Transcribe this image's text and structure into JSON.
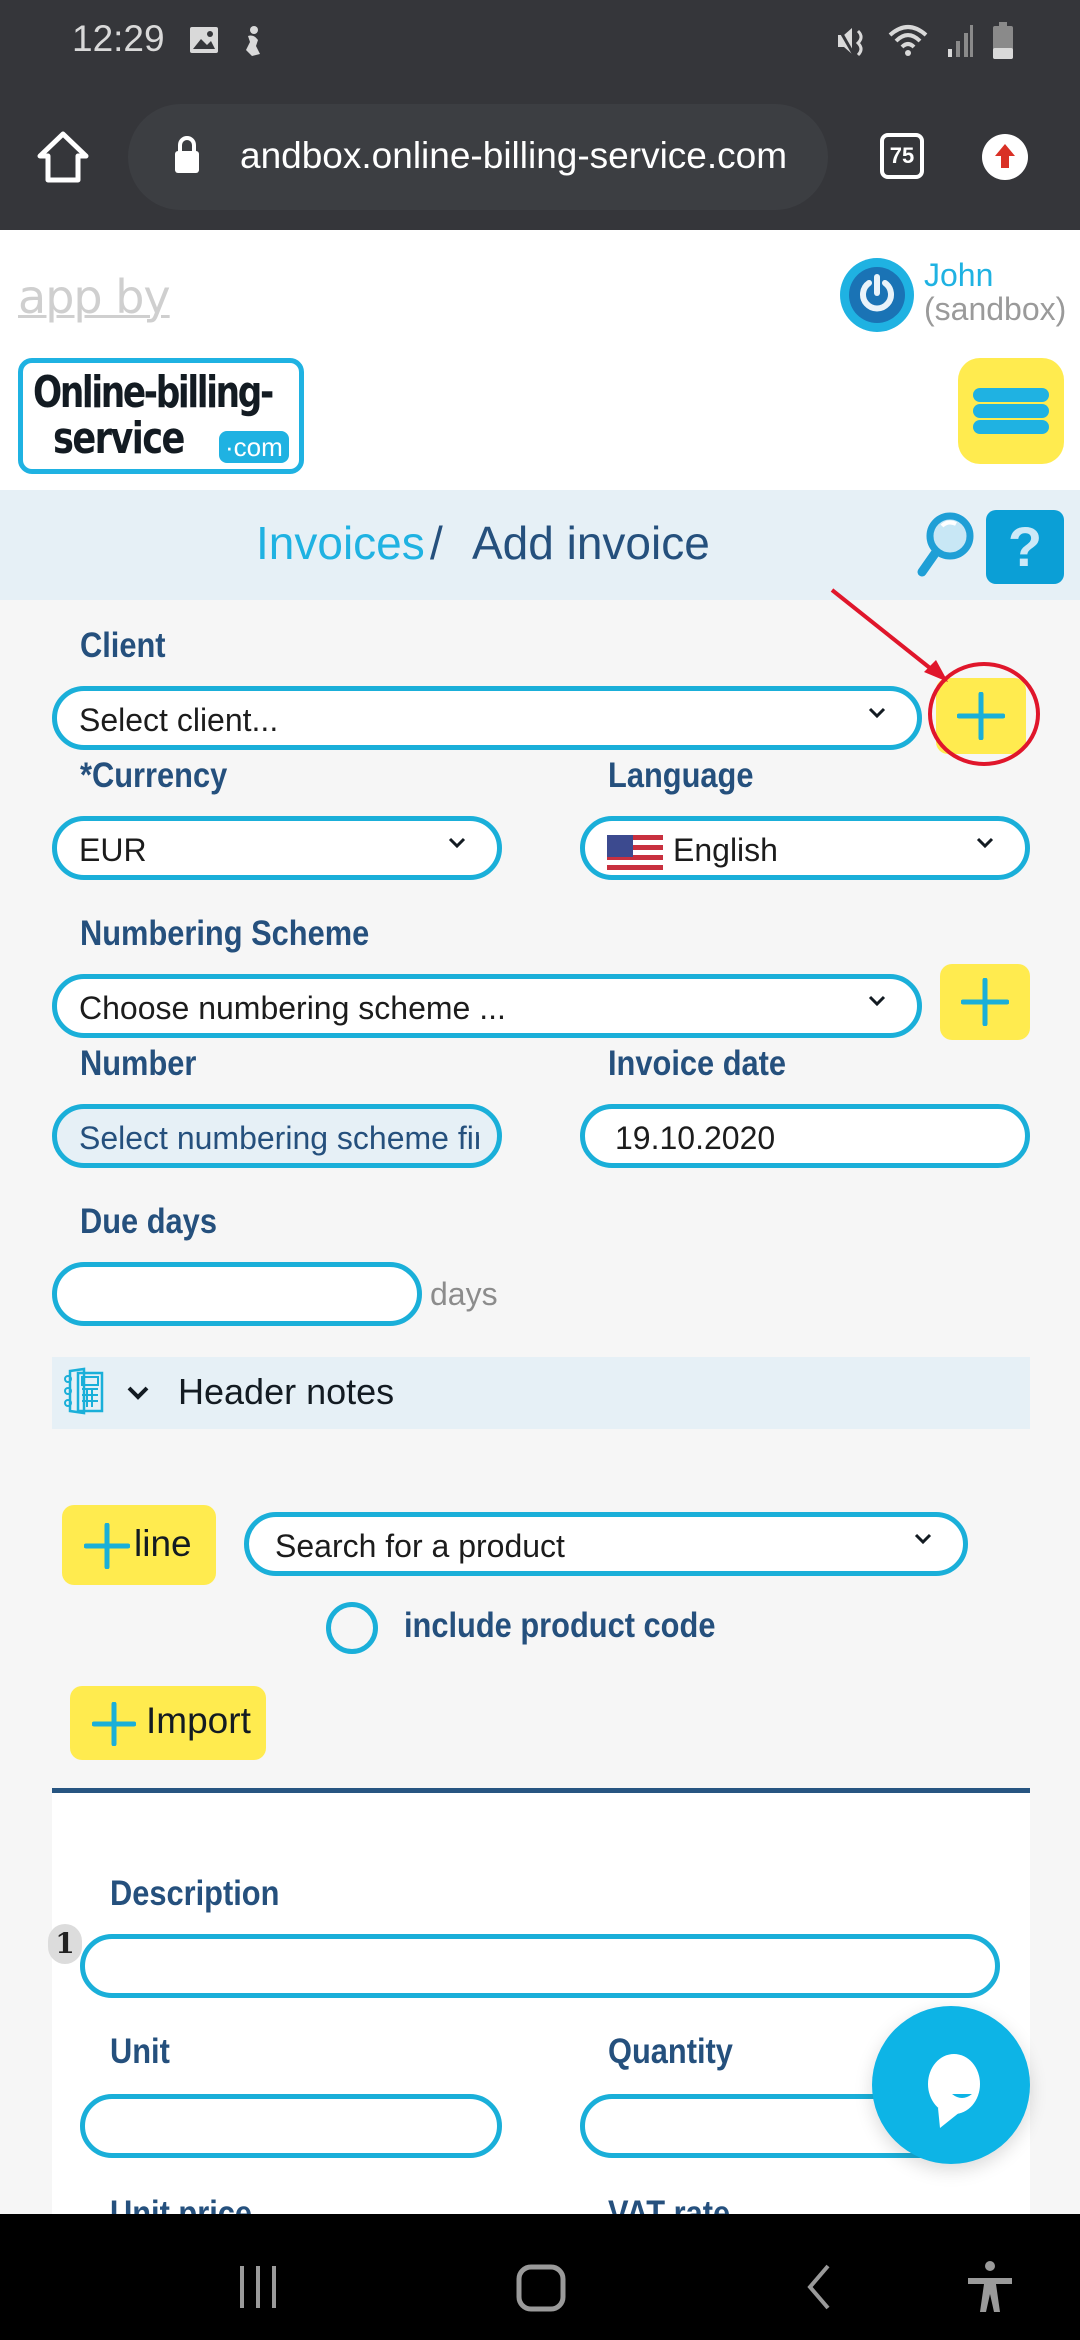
{
  "status_bar": {
    "time": "12:29",
    "left_icons": [
      "image-icon",
      "notification-icon"
    ],
    "right_icons": [
      "mute-icon",
      "wifi-icon",
      "signal-icon",
      "battery-icon"
    ]
  },
  "browser": {
    "url": "andbox.online-billing-service.com",
    "tab_count": "75"
  },
  "header": {
    "app_by": "app by",
    "logo_line1": "Online-billing-",
    "logo_line2": "service",
    "logo_com": "·com",
    "user_name": "John",
    "user_sub": "(sandbox)"
  },
  "breadcrumb": {
    "parent": "Invoices",
    "separator": "/",
    "current": "Add invoice",
    "help": "?"
  },
  "form": {
    "client": {
      "label": "Client",
      "value": "Select client..."
    },
    "currency": {
      "required_mark": "*",
      "label": "Currency",
      "value": "EUR"
    },
    "language": {
      "label": "Language",
      "value": "English"
    },
    "numbering_scheme": {
      "label": "Numbering Scheme",
      "value": "Choose numbering scheme ..."
    },
    "number": {
      "label": "Number",
      "placeholder": "Select numbering scheme first"
    },
    "invoice_date": {
      "label": "Invoice date",
      "value": "19.10.2020"
    },
    "due_days": {
      "label": "Due days",
      "value": "",
      "suffix": "days"
    },
    "header_notes": {
      "label": "Header notes"
    },
    "add_line": {
      "label": "line"
    },
    "product_search": {
      "value": "Search for a product"
    },
    "include_product_code": {
      "label": "include product code",
      "checked": false
    },
    "import": {
      "label": "Import"
    }
  },
  "line_item": {
    "index": "1",
    "description_label": "Description",
    "unit_label": "Unit",
    "quantity_label": "Quantity",
    "unit_price_label": "Unit price",
    "vat_rate_label": "VAT rate",
    "description": "",
    "unit": "",
    "quantity": ""
  },
  "colors": {
    "accent_blue": "#1aafd9",
    "navy": "#25507d",
    "yellow": "#ffeb4f",
    "annotation_red": "#e0162b"
  }
}
